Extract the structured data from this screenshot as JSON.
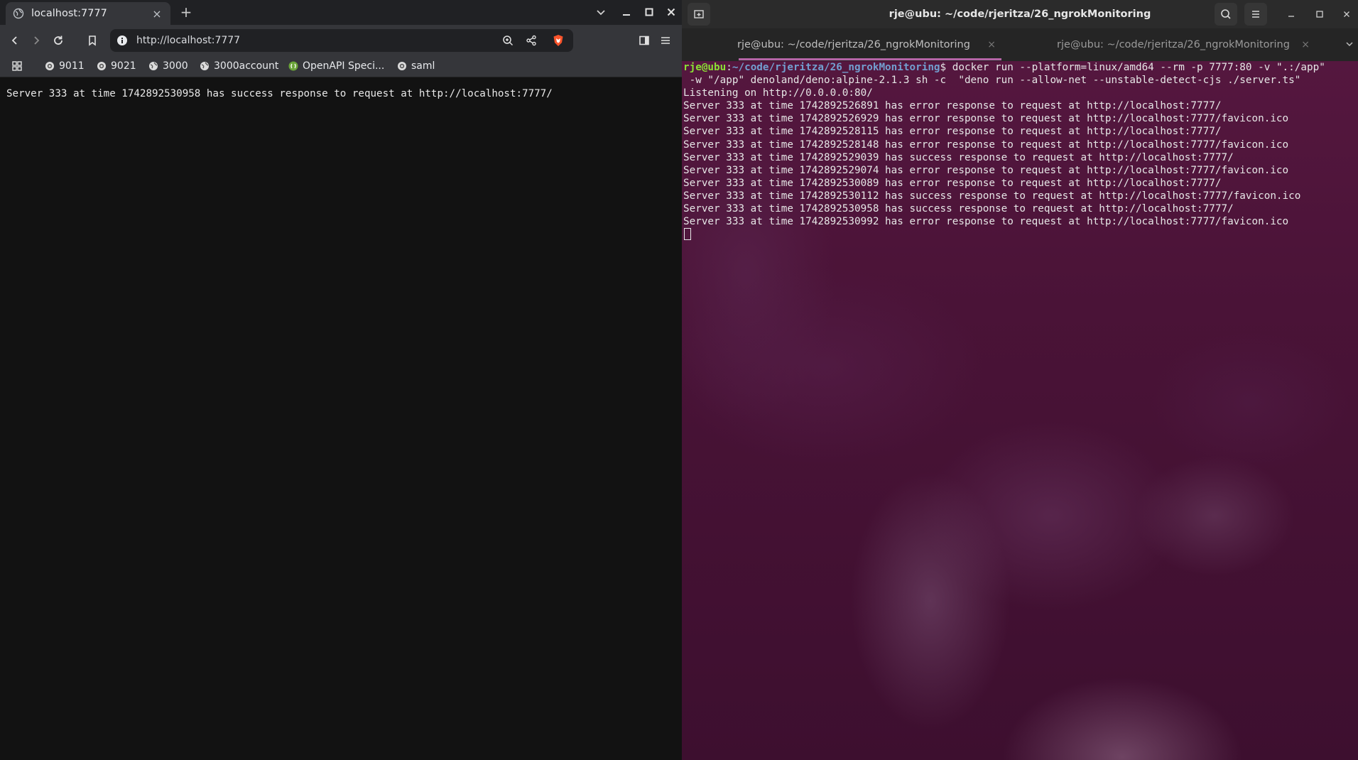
{
  "browser": {
    "tab": {
      "title": "localhost:7777",
      "close": "×"
    },
    "new_tab": "+",
    "url": "http://localhost:7777",
    "bookmarks": [
      {
        "label": "9011",
        "icon": "globe-icon"
      },
      {
        "label": "9021",
        "icon": "globe-icon"
      },
      {
        "label": "3000",
        "icon": "globe-icon"
      },
      {
        "label": "3000account",
        "icon": "globe-icon"
      },
      {
        "label": "OpenAPI Speci...",
        "icon": "openapi-icon"
      },
      {
        "label": "saml",
        "icon": "globe-icon"
      }
    ],
    "page_text": "Server 333 at time 1742892530958 has success response to request at http://localhost:7777/"
  },
  "terminal": {
    "window_title": "rje@ubu: ~/code/rjeritza/26_ngrokMonitoring",
    "tabs": [
      {
        "label": "rje@ubu: ~/code/rjeritza/26_ngrokMonitoring",
        "close": "×"
      },
      {
        "label": "rje@ubu: ~/code/rjeritza/26_ngrokMonitoring",
        "close": "×"
      }
    ],
    "prompt_user": "rje@ubu",
    "prompt_sep": ":",
    "prompt_path": "~/code/rjeritza/26_ngrokMonitoring",
    "command_line_1": "$ docker run --platform=linux/amd64 --rm -p 7777:80 -v \".:/app\"",
    "command_line_2": " -w \"/app\" denoland/deno:alpine-2.1.3 sh -c  \"deno run --allow-net --unstable-detect-cjs ./server.ts\"",
    "output_lines": [
      "Listening on http://0.0.0.0:80/",
      "Server 333 at time 1742892526891 has error response to request at http://localhost:7777/",
      "Server 333 at time 1742892526929 has error response to request at http://localhost:7777/favicon.ico",
      "Server 333 at time 1742892528115 has error response to request at http://localhost:7777/",
      "Server 333 at time 1742892528148 has error response to request at http://localhost:7777/favicon.ico",
      "Server 333 at time 1742892529039 has success response to request at http://localhost:7777/",
      "Server 333 at time 1742892529074 has error response to request at http://localhost:7777/favicon.ico",
      "Server 333 at time 1742892530089 has error response to request at http://localhost:7777/",
      "Server 333 at time 1742892530112 has success response to request at http://localhost:7777/favicon.ico",
      "Server 333 at time 1742892530958 has success response to request at http://localhost:7777/",
      "Server 333 at time 1742892530992 has error response to request at http://localhost:7777/favicon.ico"
    ]
  },
  "colors": {
    "prompt_user": "#8ae234",
    "prompt_path": "#729fcf",
    "tab_underline": "#b565a7",
    "terminal_bg": "#4a1337",
    "brave_orange": "#fb542b"
  }
}
